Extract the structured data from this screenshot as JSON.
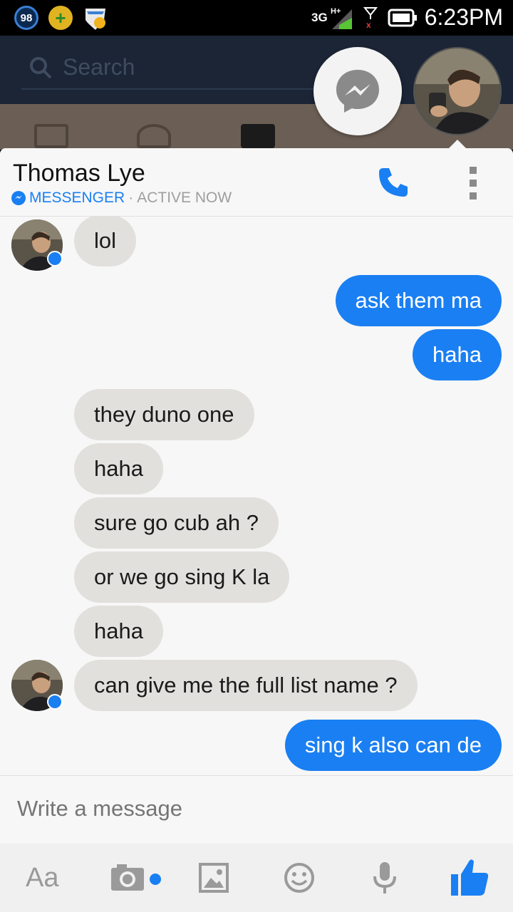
{
  "status_bar": {
    "battery_badge": "98",
    "network": "3G",
    "network_sup": "H+",
    "signal_sup": "2",
    "time": "6:23PM"
  },
  "background": {
    "search_placeholder": "Search"
  },
  "chat": {
    "contact_name": "Thomas Lye",
    "app_label": "MESSENGER",
    "separator": "·",
    "presence": "ACTIVE NOW",
    "accent_color": "#1a7ff2"
  },
  "messages": [
    {
      "from": "them",
      "text": "lol"
    },
    {
      "from": "me",
      "text": "ask them ma"
    },
    {
      "from": "me",
      "text": "haha"
    },
    {
      "from": "them",
      "text": "they duno one"
    },
    {
      "from": "them",
      "text": "haha"
    },
    {
      "from": "them",
      "text": "sure go cub ah ?"
    },
    {
      "from": "them",
      "text": "or we go sing K la"
    },
    {
      "from": "them",
      "text": "haha"
    },
    {
      "from": "them",
      "text": "can give me the full list name ?"
    },
    {
      "from": "me",
      "text": "sing k also can de"
    }
  ],
  "composer": {
    "placeholder": "Write a message"
  },
  "toolbar": {
    "text_label": "Aa",
    "icons": [
      "text-format-icon",
      "camera-icon",
      "gallery-icon",
      "emoji-icon",
      "microphone-icon",
      "thumbs-up-icon"
    ]
  }
}
